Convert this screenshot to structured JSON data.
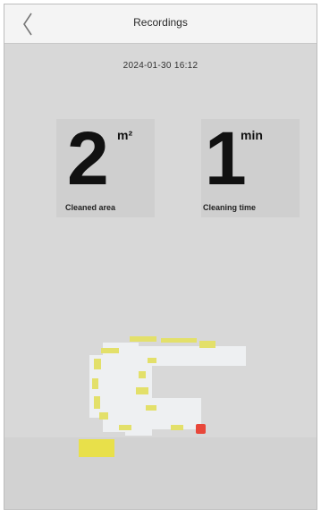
{
  "header": {
    "title": "Recordings",
    "back_icon": "chevron-left-icon"
  },
  "record": {
    "datetime": "2024-01-30 16:12"
  },
  "stats": {
    "area": {
      "value": "2",
      "unit": "m²",
      "label": "Cleaned area"
    },
    "time": {
      "value": "1",
      "unit": "min",
      "label": "Cleaning time"
    }
  },
  "map": {
    "colors": {
      "path": "#e3e06a",
      "floor": "#eef0f2",
      "dock": "#e8473a",
      "zone": "#e8e04a"
    }
  },
  "colors": {
    "background": "#d8d8d8",
    "header": "#f4f4f4"
  }
}
